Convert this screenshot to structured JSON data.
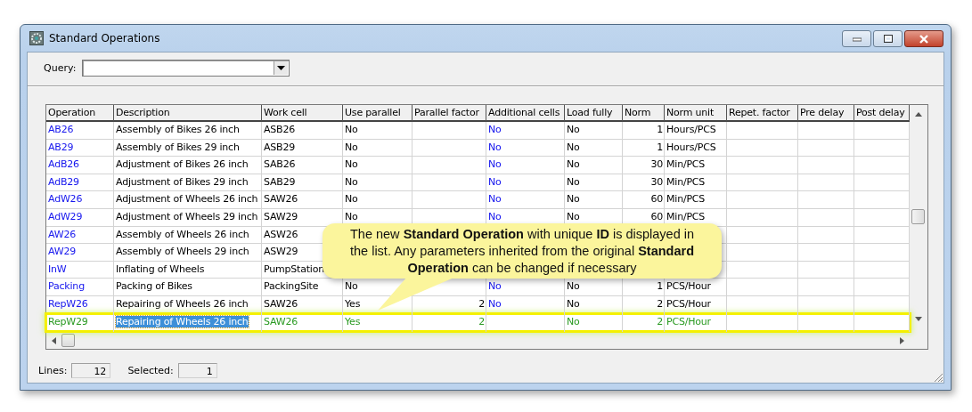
{
  "window": {
    "title": "Standard Operations"
  },
  "query": {
    "label": "Query:"
  },
  "table": {
    "columns": [
      "Operation",
      "Description",
      "Work cell",
      "Use parallel",
      "Parallel factor",
      "Additional cells",
      "Load fully",
      "Norm",
      "Norm unit",
      "Repet. factor",
      "Pre delay",
      "Post delay"
    ],
    "rows": [
      {
        "cells": [
          "AB26",
          "Assembly of Bikes 26 inch",
          "ASB26",
          "No",
          null,
          "No",
          "No",
          "1",
          "Hours/PCS",
          null,
          null,
          null
        ],
        "selected": false,
        "new": false
      },
      {
        "cells": [
          "AB29",
          "Assembly of Bikes 29 inch",
          "ASB29",
          "No",
          null,
          "No",
          "No",
          "1",
          "Hours/PCS",
          null,
          null,
          null
        ],
        "selected": false,
        "new": false
      },
      {
        "cells": [
          "AdB26",
          "Adjustment of Bikes 26 inch",
          "SAB26",
          "No",
          null,
          "No",
          "No",
          "30",
          "Min/PCS",
          null,
          null,
          null
        ],
        "selected": false,
        "new": false
      },
      {
        "cells": [
          "AdB29",
          "Adjustment of Bikes 29 inch",
          "SAB29",
          "No",
          null,
          "No",
          "No",
          "30",
          "Min/PCS",
          null,
          null,
          null
        ],
        "selected": false,
        "new": false
      },
      {
        "cells": [
          "AdW26",
          "Adjustment of Wheels 26 inch",
          "SAW26",
          "No",
          null,
          "No",
          "No",
          "60",
          "Min/PCS",
          null,
          null,
          null
        ],
        "selected": false,
        "new": false
      },
      {
        "cells": [
          "AdW29",
          "Adjustment of Wheels 29 inch",
          "SAW29",
          "No",
          null,
          "No",
          "No",
          "60",
          "Min/PCS",
          null,
          null,
          null
        ],
        "selected": false,
        "new": false
      },
      {
        "cells": [
          "AW26",
          "Assembly of Wheels 26 inch",
          "ASW26",
          null,
          null,
          null,
          null,
          null,
          null,
          null,
          null,
          null
        ],
        "selected": false,
        "new": false
      },
      {
        "cells": [
          "AW29",
          "Assembly of Wheels 29 inch",
          "ASW29",
          null,
          null,
          null,
          null,
          null,
          null,
          null,
          null,
          null
        ],
        "selected": false,
        "new": false
      },
      {
        "cells": [
          "InW",
          "Inflating of Wheels",
          "PumpStation",
          null,
          null,
          null,
          null,
          null,
          null,
          null,
          null,
          null
        ],
        "selected": false,
        "new": false
      },
      {
        "cells": [
          "Packing",
          "Packing of Bikes",
          "PackingSite",
          "No",
          null,
          "No",
          "No",
          "1",
          "PCS/Hour",
          null,
          null,
          null
        ],
        "selected": false,
        "new": false
      },
      {
        "cells": [
          "RepW26",
          "Repairing of Wheels 26 inch",
          "SAW26",
          "Yes",
          "2",
          "No",
          "No",
          "2",
          "PCS/Hour",
          null,
          null,
          null
        ],
        "selected": false,
        "new": false
      },
      {
        "cells": [
          "RepW29",
          "Repairing of Wheels 26 inch",
          "SAW26",
          "Yes",
          "2",
          null,
          "No",
          "2",
          "PCS/Hour",
          null,
          null,
          null
        ],
        "selected": true,
        "new": true
      }
    ]
  },
  "status_bar": {
    "lines_label": "Lines:",
    "lines": "12",
    "selected_label": "Selected:",
    "selected": "1"
  },
  "callout": {
    "text": "The new **Standard Operation** with unique **ID** is displayed in the list. Any parameters inherited from the original **Standard Operation** can be changed if necessary"
  }
}
